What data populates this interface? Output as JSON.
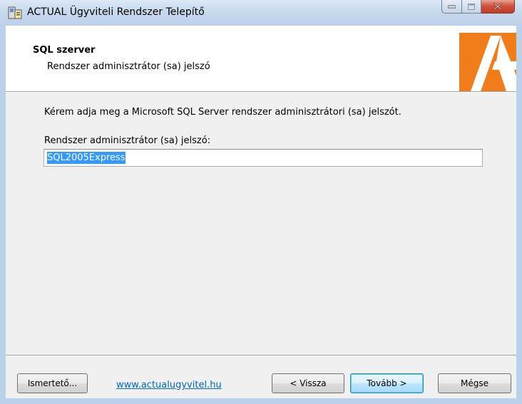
{
  "window": {
    "title": "ACTUAL Ügyviteli Rendszer Telepítő"
  },
  "header": {
    "title": "SQL szerver",
    "subtitle": "Rendszer adminisztrátor (sa) jelszó"
  },
  "content": {
    "instruction": "Kérem adja meg a Microsoft SQL Server rendszer adminisztrátori (sa) jelszót.",
    "field_label": "Rendszer adminisztrátor (sa) jelszó:",
    "password_value": "SQL2005Express"
  },
  "footer": {
    "info_button": "Ismertető...",
    "link_text": "www.actualugyvitel.hu",
    "back_button": "< Vissza",
    "next_button": "Tovább >",
    "cancel_button": "Mégse"
  },
  "colors": {
    "logo_orange": "#f07d1a",
    "selection": "#3399ff",
    "link": "#0066cc"
  },
  "icons": {
    "app": "installer-icon",
    "minimize": "minimize-icon",
    "maximize": "maximize-icon",
    "close": "close-icon",
    "logo": "actual-logo"
  }
}
